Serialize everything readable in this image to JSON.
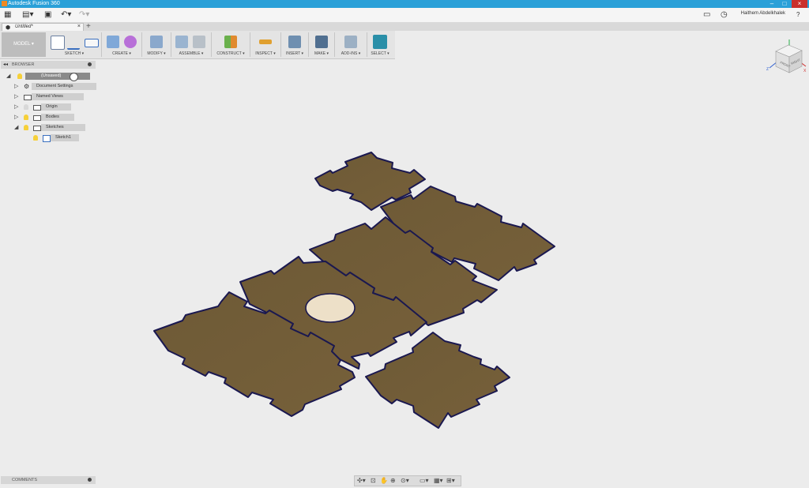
{
  "window": {
    "title": "Autodesk Fusion 360"
  },
  "appbar": {
    "user": "Haithem Abdelkhalek",
    "help": "?"
  },
  "tab": {
    "name": "Untitled*",
    "close": "×",
    "add": "+"
  },
  "toolbar": {
    "mode": "MODEL ▾",
    "groups": [
      "SKETCH ▾",
      "CREATE ▾",
      "MODIFY ▾",
      "ASSEMBLE ▾",
      "CONSTRUCT ▾",
      "INSPECT ▾",
      "INSERT ▾",
      "MAKE ▾",
      "ADD-INS ▾",
      "SELECT ▾"
    ]
  },
  "browser": {
    "title": "BROWSER",
    "items": [
      {
        "label": "(Unsaved)"
      },
      {
        "label": "Document Settings"
      },
      {
        "label": "Named Views"
      },
      {
        "label": "Origin"
      },
      {
        "label": "Bodies"
      },
      {
        "label": "Sketches"
      },
      {
        "label": "Sketch1"
      }
    ]
  },
  "comments": {
    "title": "COMMENTS"
  },
  "viewcube": {
    "front": "FRONT",
    "right": "RIGHT",
    "z": "Z",
    "x": "X"
  },
  "colors": {
    "panel": "#705a35",
    "edge": "#1a1850",
    "hole": "#ede0c8"
  }
}
